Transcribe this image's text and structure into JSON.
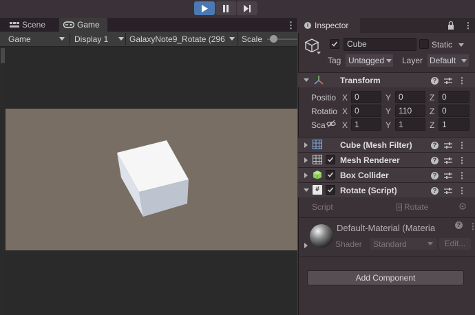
{
  "toolbar": {
    "play_icon": "play-icon",
    "pause_icon": "pause-icon",
    "step_icon": "step-icon",
    "play_color": "#4b79b4"
  },
  "tabs": [
    {
      "label": "Scene",
      "icon": "scene-icon"
    },
    {
      "label": "Game",
      "icon": "gamepad-icon"
    }
  ],
  "game_toolbar": {
    "mode": "Game",
    "display": "Display 1",
    "resolution": "GalaxyNote9_Rotate (296",
    "scale_label": "Scale"
  },
  "viewport": {
    "background": "#786e63",
    "object": "white cube"
  },
  "inspector": {
    "title": "Inspector",
    "object_name": "Cube",
    "static_label": "Static",
    "tag_label": "Tag",
    "tag_value": "Untagged",
    "layer_label": "Layer",
    "layer_value": "Default",
    "transform": {
      "title": "Transform",
      "position_label": "Positio",
      "rotation_label": "Rotatio",
      "scale_label": "Sca",
      "position": {
        "x": "0",
        "y": "0",
        "z": "0"
      },
      "rotation": {
        "x": "0",
        "y": "110",
        "z": "0"
      },
      "scale": {
        "x": "1",
        "y": "1",
        "z": "1"
      }
    },
    "components": [
      {
        "name": "Cube (Mesh Filter)",
        "checkbox": false,
        "icon": "mesh-filter-icon"
      },
      {
        "name": "Mesh Renderer",
        "checkbox": true,
        "icon": "mesh-renderer-icon"
      },
      {
        "name": "Box Collider",
        "checkbox": true,
        "icon": "box-collider-icon"
      },
      {
        "name": "Rotate (Script)",
        "checkbox": true,
        "icon": "script-icon"
      }
    ],
    "script_label": "Script",
    "script_value": "Rotate",
    "material_name": "Default-Material (Materia",
    "shader_label": "Shader",
    "shader_value": "Standard",
    "edit_label": "Edit...",
    "add_component": "Add Component"
  }
}
